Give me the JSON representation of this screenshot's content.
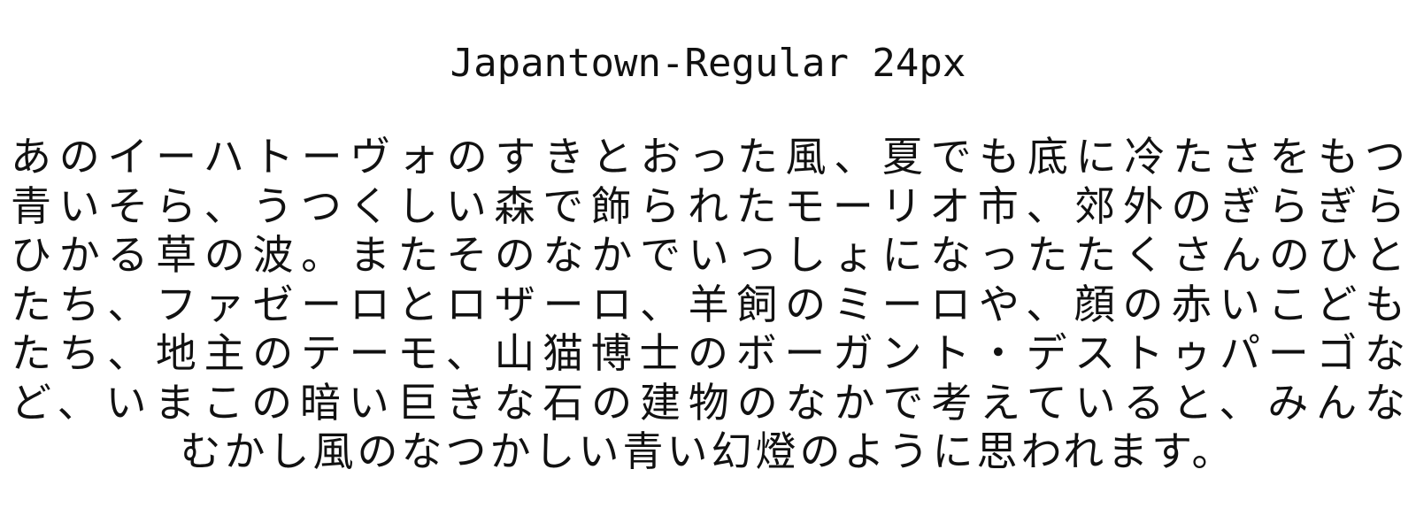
{
  "title": "Japantown-Regular 24px",
  "sample_lines": [
    "あのイーハトーヴォのすきとおった風、夏でも底に冷たさをもつ",
    "青いそら、うつくしい森で飾られたモーリオ市、郊外のぎらぎら",
    "ひかる草の波。またそのなかでいっしょになったたくさんのひと",
    "たち、ファゼーロとロザーロ、羊飼のミーロや、顔の赤いこども",
    "たち、地主のテーモ、山猫博士のボーガント・デストゥパーゴな",
    "ど、いまこの暗い巨きな石の建物のなかで考えていると、みんな",
    "むかし風のなつかしい青い幻燈のように思われます。"
  ]
}
